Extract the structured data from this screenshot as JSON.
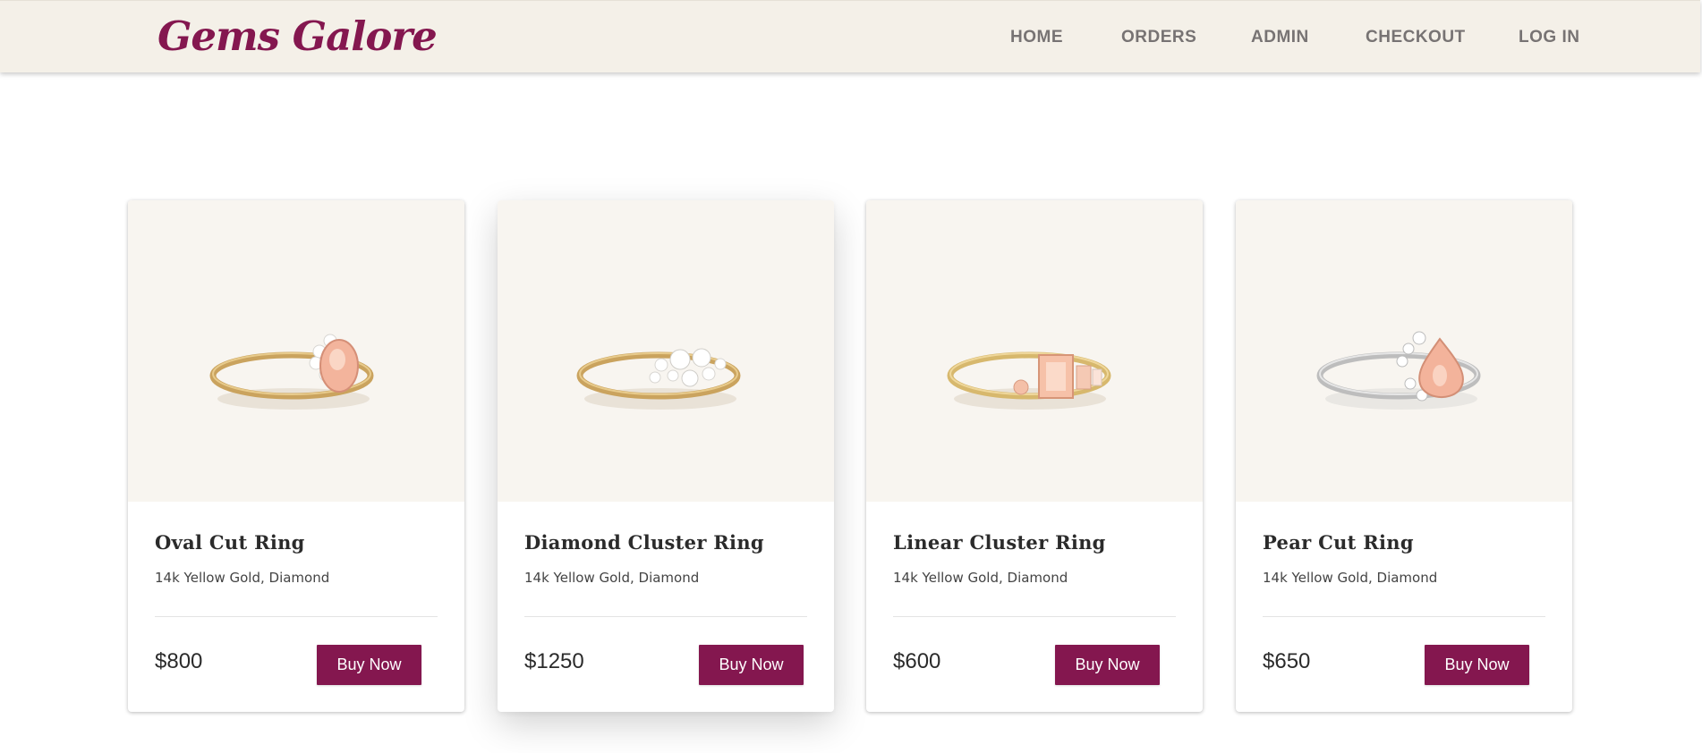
{
  "brand": {
    "name": "Gems Galore",
    "color": "#84174f"
  },
  "nav": {
    "items": [
      {
        "label": "HOME"
      },
      {
        "label": "ORDERS"
      },
      {
        "label": "ADMIN"
      },
      {
        "label": "CHECKOUT"
      },
      {
        "label": "LOG IN"
      }
    ]
  },
  "products": [
    {
      "name": "Oval Cut Ring",
      "material": "14k Yellow Gold, Diamond",
      "price": "$800",
      "button": "Buy Now",
      "band_metal": "yellow-gold",
      "center_stone": "oval-peach-stone"
    },
    {
      "name": "Diamond Cluster Ring",
      "material": "14k Yellow Gold, Diamond",
      "price": "$1250",
      "button": "Buy Now",
      "band_metal": "yellow-gold",
      "center_stone": "diamond-cluster"
    },
    {
      "name": "Linear Cluster Ring",
      "material": "14k Yellow Gold, Diamond",
      "price": "$600",
      "button": "Buy Now",
      "band_metal": "yellow-gold",
      "center_stone": "emerald-cut-peach-stone"
    },
    {
      "name": "Pear Cut Ring",
      "material": "14k Yellow Gold, Diamond",
      "price": "$650",
      "button": "Buy Now",
      "band_metal": "white-gold",
      "center_stone": "pear-peach-stone"
    }
  ],
  "colors": {
    "navbar_bg": "#f4f0e8",
    "accent": "#84174f",
    "card_media_bg": "#f8f5f0"
  }
}
